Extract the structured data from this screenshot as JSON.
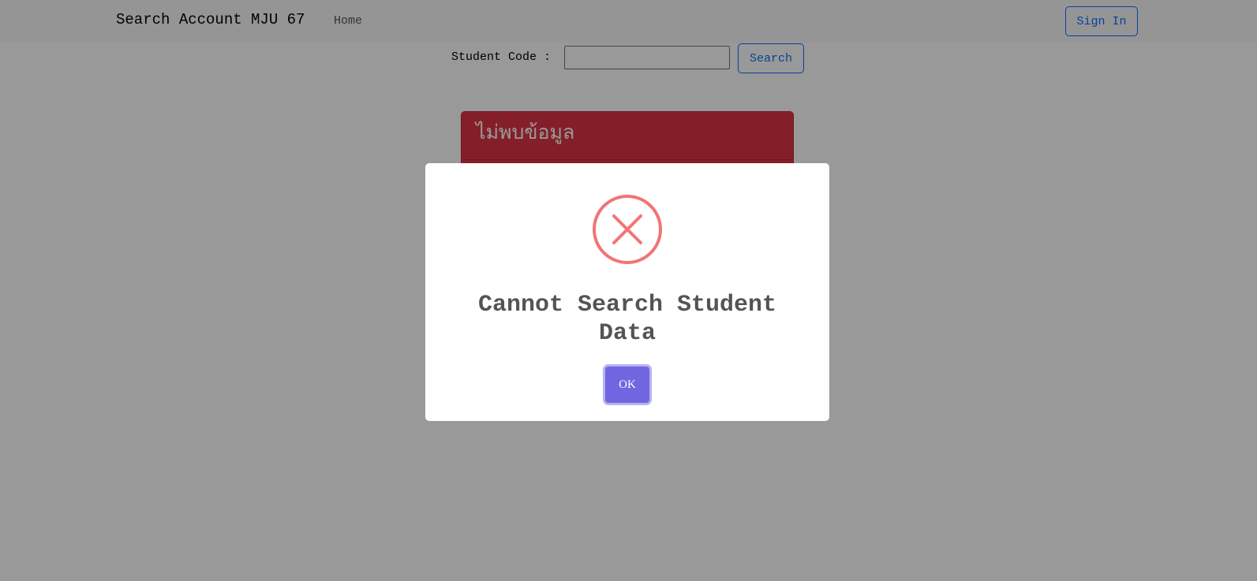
{
  "navbar": {
    "brand": "Search Account MJU 67",
    "home_link": "Home",
    "signin_label": "Sign In"
  },
  "search": {
    "label": "Student Code :",
    "input_value": "",
    "button_label": "Search"
  },
  "alert": {
    "title": "ไม่พบข้อมูล",
    "color": "#dc3545"
  },
  "modal": {
    "icon": "error-x-icon",
    "icon_color": "#f27474",
    "title": "Cannot Search Student Data",
    "ok_label": "OK",
    "ok_color": "#7066e0"
  }
}
